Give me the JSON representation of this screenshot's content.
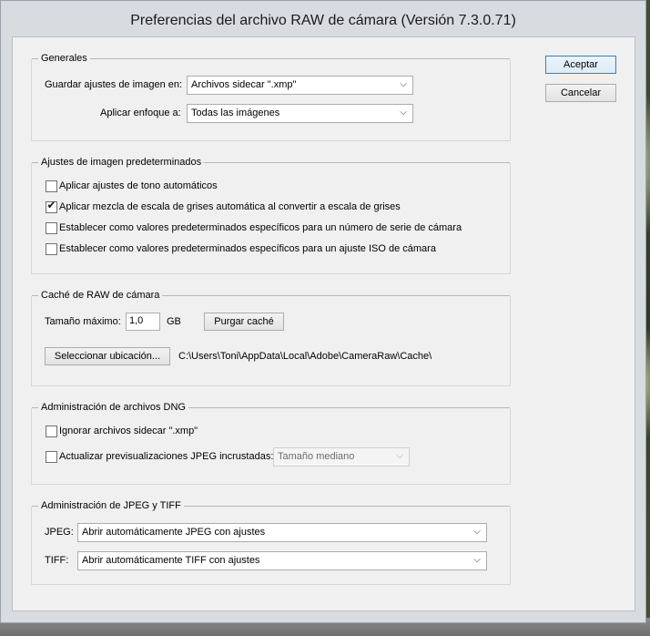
{
  "window": {
    "title": "Preferencias del archivo RAW de cámara  (Versión 7.3.0.71)"
  },
  "buttons": {
    "ok": "Aceptar",
    "cancel": "Cancelar"
  },
  "general": {
    "title": "Generales",
    "save_label": "Guardar ajustes de imagen en:",
    "save_value": "Archivos sidecar \".xmp\"",
    "sharpen_label": "Aplicar enfoque a:",
    "sharpen_value": "Todas las imágenes"
  },
  "defaults": {
    "title": "Ajustes de imagen predeterminados",
    "items": [
      {
        "label": "Aplicar ajustes de tono automáticos",
        "checked": false
      },
      {
        "label": "Aplicar mezcla de escala de grises automática al convertir a escala de grises",
        "checked": true
      },
      {
        "label": "Establecer como valores predeterminados específicos para un número de serie de cámara",
        "checked": false
      },
      {
        "label": "Establecer como valores predeterminados específicos para un ajuste ISO de cámara",
        "checked": false
      }
    ],
    "check_glyph": "✔"
  },
  "cache": {
    "title": "Caché de RAW de cámara",
    "max_size_label": "Tamaño máximo:",
    "max_size_value": "1,0",
    "unit": "GB",
    "purge_button": "Purgar caché",
    "select_location_button": "Seleccionar ubicación...",
    "path": "C:\\Users\\Toni\\AppData\\Local\\Adobe\\CameraRaw\\Cache\\"
  },
  "dng": {
    "title": "Administración de archivos DNG",
    "ignore_sidecar": {
      "label": "Ignorar archivos sidecar \".xmp\"",
      "checked": false
    },
    "update_previews": {
      "label": "Actualizar previsualizaciones JPEG incrustadas:",
      "checked": false
    },
    "preview_size_value": "Tamaño mediano"
  },
  "jpeg_tiff": {
    "title": "Administración de JPEG y TIFF",
    "jpeg_label": "JPEG:",
    "jpeg_value": "Abrir automáticamente JPEG con ajustes",
    "tiff_label": "TIFF:",
    "tiff_value": "Abrir automáticamente TIFF con ajustes"
  },
  "icons": {
    "dropdown_arrow": "⌵"
  },
  "colors": {
    "dialog_bg": "#f0f0f0",
    "default_button_border": "#3c7fb1"
  }
}
